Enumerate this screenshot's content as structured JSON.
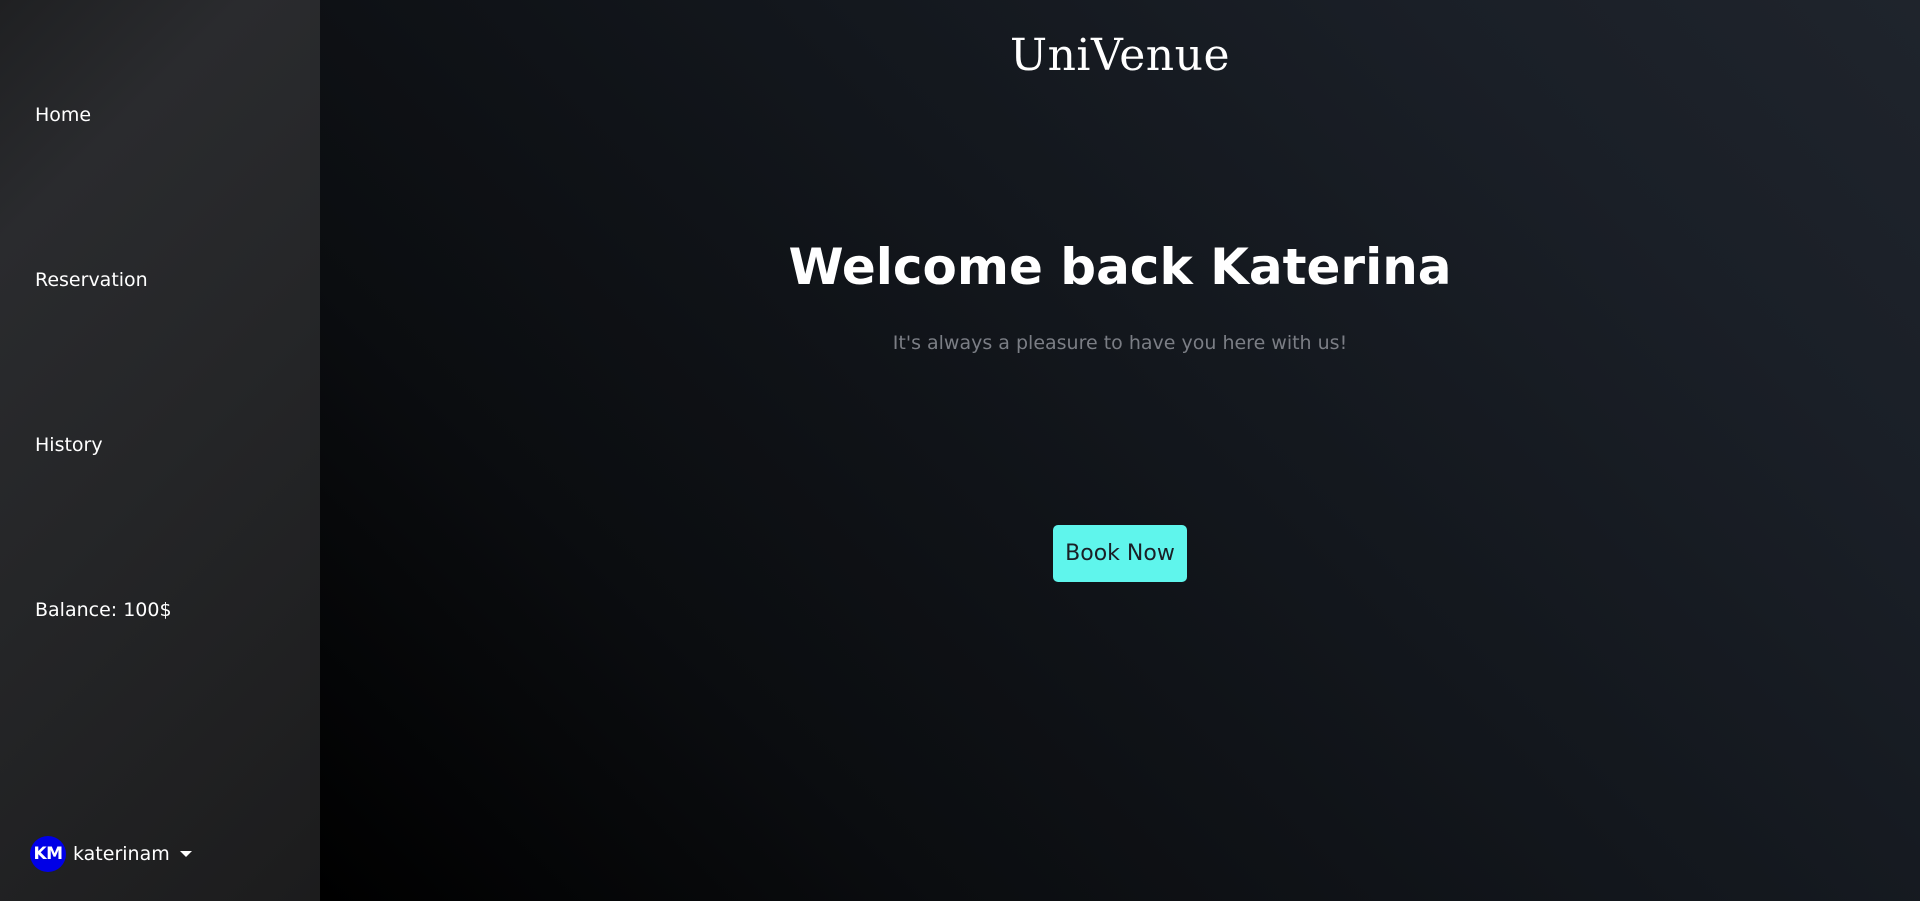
{
  "sidebar": {
    "items": [
      {
        "label": "Home"
      },
      {
        "label": "Reservation"
      },
      {
        "label": "History"
      }
    ],
    "balance": "Balance: 100$"
  },
  "user": {
    "initials": "KM",
    "username": "katerinam",
    "avatar_color": "#0000e6"
  },
  "main": {
    "brand": "UniVenue",
    "welcome": "Welcome back Katerina",
    "subtitle": "It's always a pleasure to have you here with us!",
    "cta_label": "Book Now",
    "accent": "#5ff5ec"
  }
}
